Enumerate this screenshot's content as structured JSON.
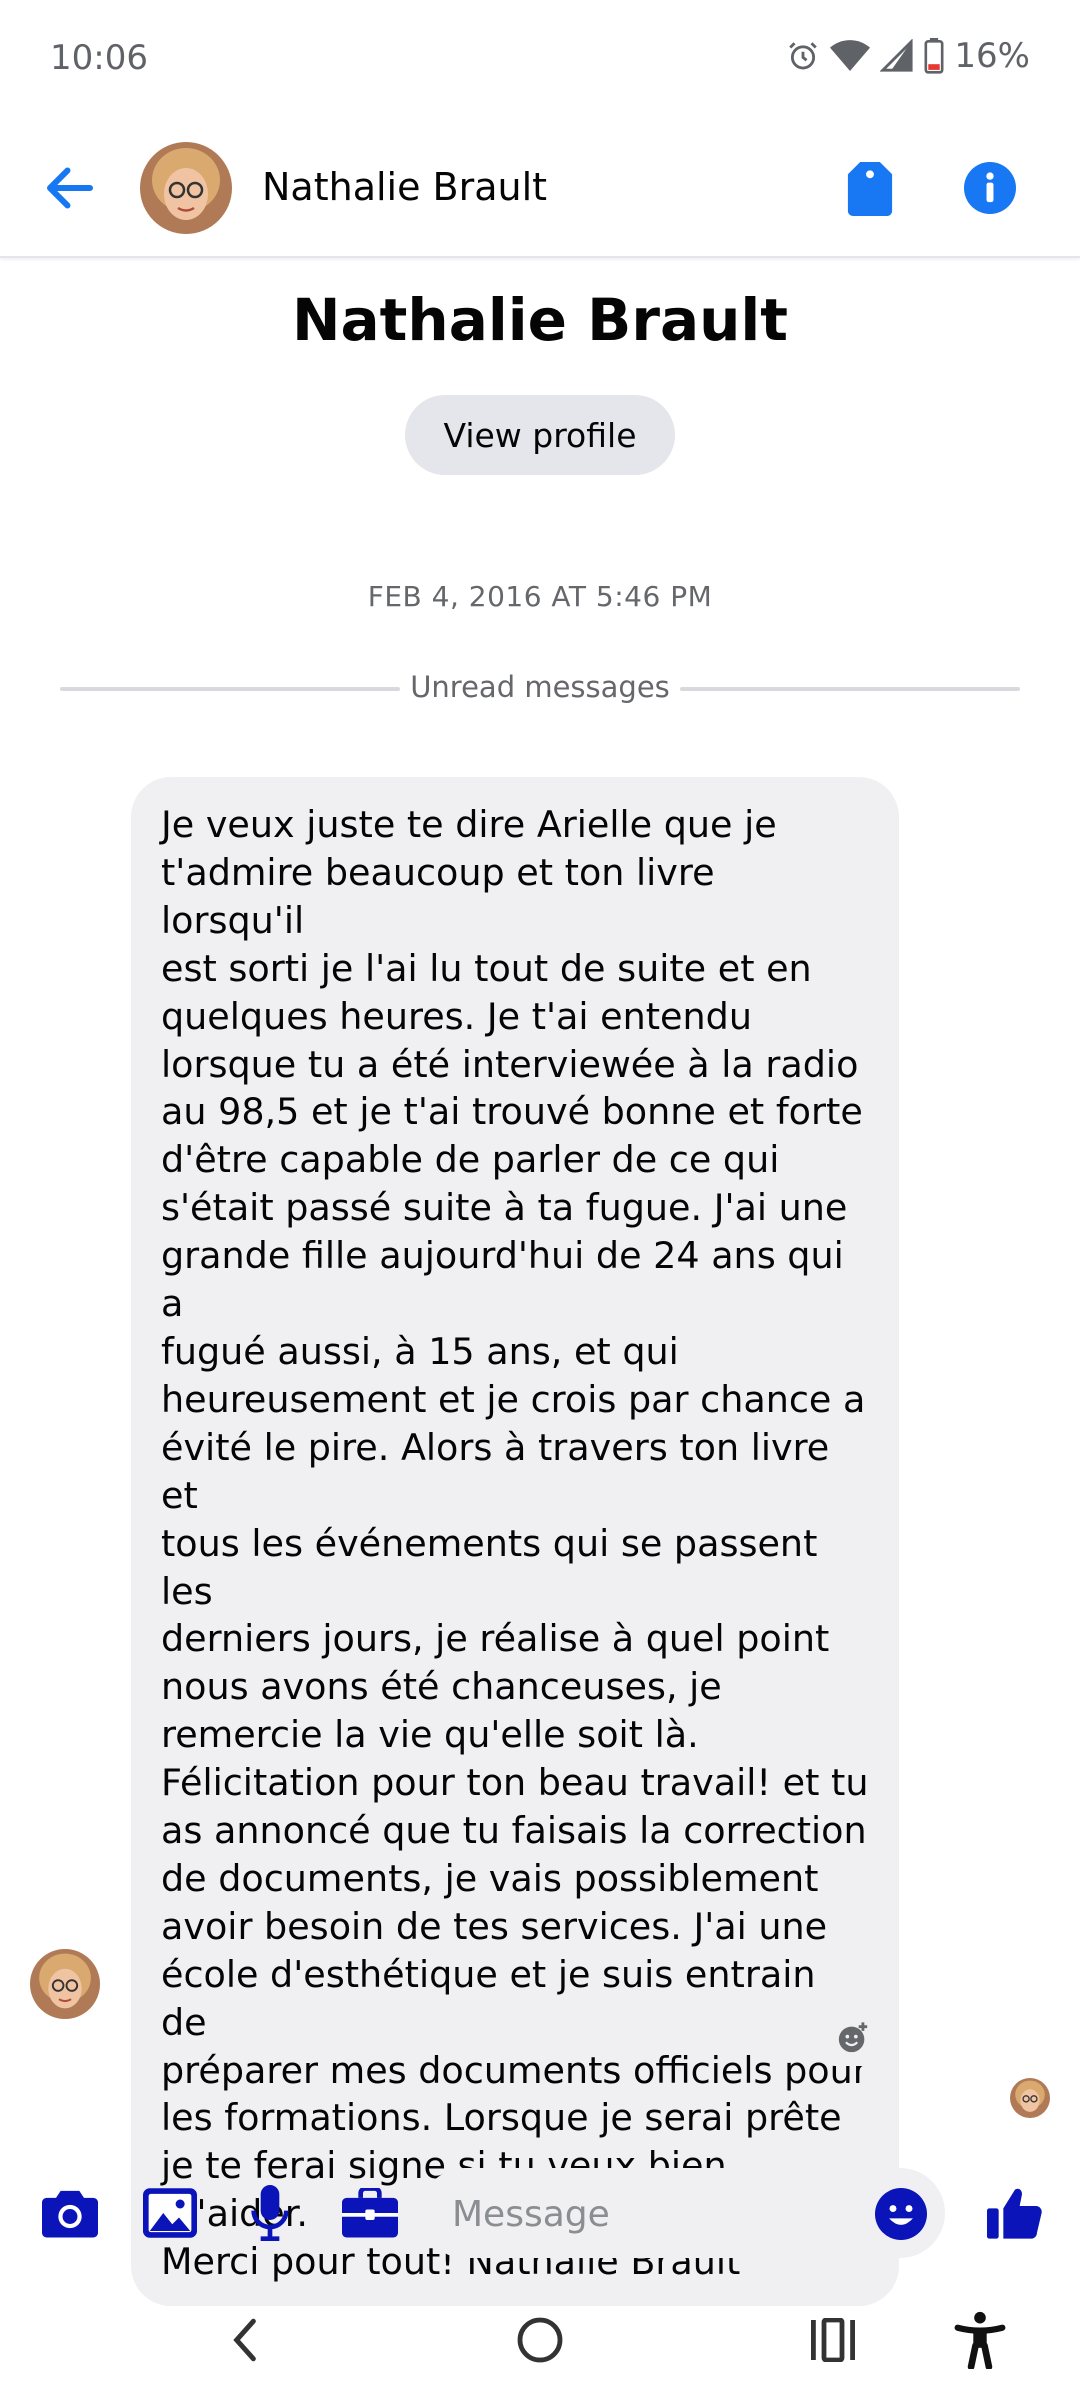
{
  "status_bar": {
    "time": "10:06",
    "battery_percent": "16%",
    "icons": [
      "alarm-icon",
      "wifi-icon",
      "signal-icon",
      "battery-icon"
    ]
  },
  "header": {
    "contact_name": "Nathalie Brault",
    "icons": [
      "back-arrow-icon",
      "tag-icon",
      "info-icon"
    ]
  },
  "profile": {
    "name": "Nathalie Brault",
    "view_profile_label": "View profile"
  },
  "thread": {
    "date_stamp": "FEB 4, 2016 AT 5:46 PM",
    "unread_divider": "Unread messages",
    "message_lines": [
      "Je veux juste te dire Arielle que je",
      "t'admire beaucoup et ton livre lorsqu'il",
      "est sorti je l'ai lu tout de suite et en",
      "quelques heures. Je t'ai entendu",
      "lorsque tu a été interviewée à la radio",
      "au 98,5 et je t'ai trouvé bonne et forte",
      "d'être capable de parler de ce qui",
      "s'était passé suite à ta fugue. J'ai une",
      "grande fille aujourd'hui de 24 ans qui a",
      "fugué aussi, à 15 ans, et qui",
      "heureusement et je crois par chance a",
      "évité le pire. Alors à travers ton livre et",
      "tous les événements qui se passent les",
      "derniers jours, je réalise à quel point",
      "nous avons été chanceuses, je",
      "remercie la vie qu'elle soit là.",
      "Félicitation pour ton beau travail! et tu",
      "as annoncé que tu faisais la correction",
      "de documents, je vais possiblement",
      "avoir besoin de tes services. J'ai une",
      "école d'esthétique et je suis entrain de",
      "préparer mes documents officiels pour",
      "les formations. Lorsque je serai prête",
      "je te ferai signe si tu veux bien m'aider.",
      "Merci pour tout! Nathalie Brault"
    ]
  },
  "composer": {
    "placeholder": "Message",
    "icons": [
      "camera-icon",
      "gallery-icon",
      "microphone-icon",
      "briefcase-icon",
      "emoji-icon",
      "thumbs-up-icon"
    ]
  },
  "colors": {
    "accent": "#1877f2",
    "composer_icon": "#0a14b8",
    "bubble": "#f0f0f2"
  }
}
